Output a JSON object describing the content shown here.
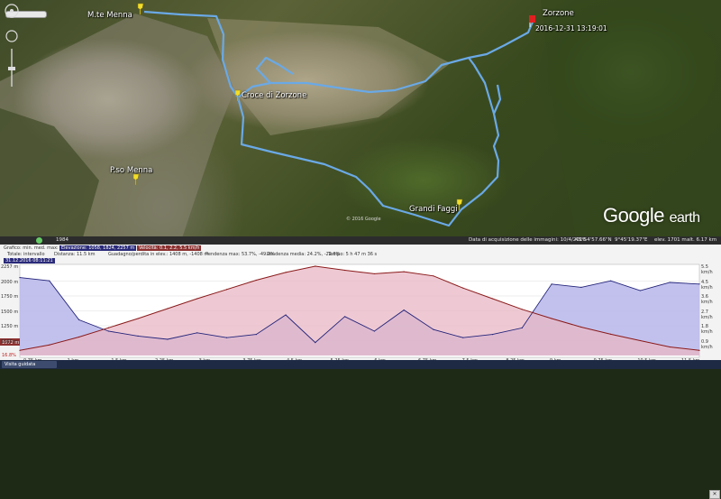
{
  "places": {
    "mte_menna": "M.te Menna",
    "zorzone": "Zorzone",
    "croce_zorzone": "Croce di Zorzone",
    "pso_menna": "P.so Menna",
    "grandi_faggi": "Grandi Faggi",
    "timestamp": "2016-12-31 13:19:01"
  },
  "branding": {
    "logo_google": "Google",
    "logo_earth": "earth",
    "copyright": "© 2016 Google"
  },
  "status_bar": {
    "scale": "1984",
    "imagery_date": "Data di acquisizione delle immagini: 10/4/2016",
    "lat": "45°54'57.66\"N",
    "lon": "9°45'19.37\"E",
    "elev": "elev. 1701 m",
    "alt": "alt. 6.17 km"
  },
  "profile": {
    "row1_label": "Grafico: min. med. max:",
    "row1_elev": "Elevazione: 1058, 1824, 2257 m",
    "row1_speed": "Velocità: 0.1, 2.2, 5.5 km/h",
    "row2_total": "Totale: intervallo",
    "row2_distance": "Distanza: 11.5 km",
    "row2_gain": "Guadagno/perdita in elev.: 1408 m, -1408 m",
    "row2_slope": "Pendenza max: 53.7%, -49.2%",
    "row2_avgslope": "Pendenza media: 24.2%, -22.6%",
    "row2_time": "Tempo: 5 h 47 m 36 s",
    "selection_label": "31.12.2016 08:11:21",
    "marker_elev": "1072 m",
    "marker_pct": "16.8%"
  },
  "chart_data": {
    "type": "area",
    "title": "",
    "xlabel": "",
    "ylabel": "",
    "x_ticks": [
      "0.75 km",
      "1 km",
      "1.5 km",
      "2.25 km",
      "3 km",
      "3.75 km",
      "4.5 km",
      "5.25 km",
      "6 km",
      "6.75 km",
      "7.5 km",
      "8.25 km",
      "9 km",
      "9.75 km",
      "10.5 km",
      "11.5 km"
    ],
    "y_ticks_left": [
      "2257 m",
      "2000 m",
      "1750 m",
      "1500 m",
      "1250 m",
      "1000 m"
    ],
    "y_ticks_right": [
      "5.5 km/h",
      "4.5 km/h",
      "3.6 km/h",
      "2.7 km/h",
      "1.8 km/h",
      "0.9 km/h"
    ],
    "ylim": [
      1000,
      2257
    ],
    "series": [
      {
        "name": "Elevazione",
        "color": "#8a1a1a",
        "x": [
          0,
          0.5,
          1,
          1.5,
          2,
          2.5,
          3,
          3.5,
          4,
          4.5,
          5,
          5.5,
          6,
          6.5,
          7,
          7.5,
          8,
          8.5,
          9,
          9.5,
          10,
          10.5,
          11,
          11.5
        ],
        "y": [
          1072,
          1150,
          1260,
          1390,
          1520,
          1660,
          1800,
          1930,
          2060,
          2170,
          2257,
          2200,
          2150,
          2180,
          2120,
          1950,
          1800,
          1650,
          1520,
          1400,
          1300,
          1210,
          1120,
          1072
        ]
      },
      {
        "name": "Velocità",
        "color": "#23237a",
        "x": [
          0,
          0.5,
          1,
          1.5,
          2,
          2.5,
          3,
          3.5,
          4,
          4.5,
          5,
          5.5,
          6,
          6.5,
          7,
          7.5,
          8,
          8.5,
          9,
          9.5,
          10,
          10.5,
          11,
          11.5
        ],
        "y": [
          4.8,
          4.6,
          2.2,
          1.5,
          1.2,
          1.0,
          1.4,
          1.1,
          1.3,
          2.5,
          0.8,
          2.4,
          1.5,
          2.8,
          1.6,
          1.1,
          1.3,
          1.7,
          4.4,
          4.2,
          4.6,
          4.0,
          4.5,
          4.4
        ]
      }
    ]
  },
  "visit_button": "Visita guidata",
  "close_label": "✕",
  "colors": {
    "track": "#6aa9e6",
    "elev_fill": "#e8b7c4",
    "speed_fill": "#b7b6ea"
  }
}
